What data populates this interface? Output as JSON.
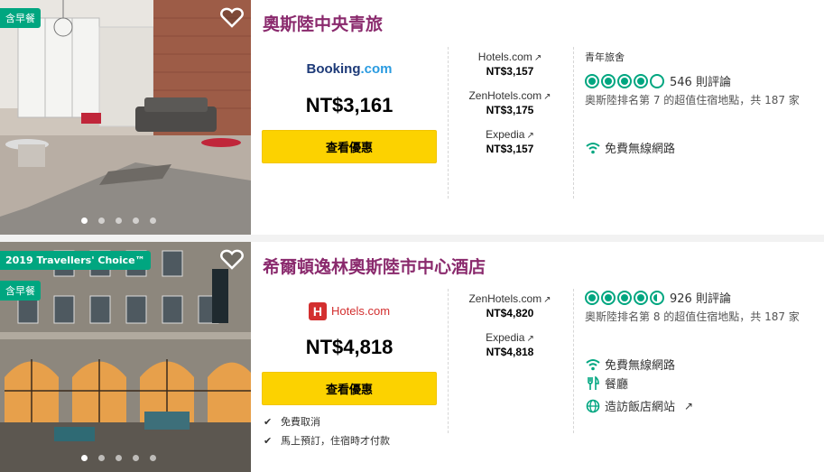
{
  "colors": {
    "brand": "#8a2a6d",
    "badge": "#00a680",
    "button": "#fcd200",
    "rating": "#00a680"
  },
  "hotels": [
    {
      "badge_breakfast": "含早餐",
      "title": "奧斯陸中央青旅",
      "provider": "Booking.com",
      "provider_part1": "Booking",
      "provider_part2": ".com",
      "price": "NT$3,161",
      "button": "查看優惠",
      "offers": [
        {
          "name": "Hotels.com",
          "price": "NT$3,157"
        },
        {
          "name": "ZenHotels.com",
          "price": "NT$3,175"
        },
        {
          "name": "Expedia",
          "price": "NT$3,157"
        }
      ],
      "category": "青年旅舍",
      "rating": 4,
      "reviews": "546 則評論",
      "rank": "奧斯陸排名第 7 的超值住宿地點，共 187 家",
      "amenities": [
        {
          "icon": "wifi-icon",
          "label": "免費無線網路"
        }
      ]
    },
    {
      "badge_award": "2019 Travellers' Choice™",
      "badge_breakfast": "含早餐",
      "title": "希爾頓逸林奧斯陸市中心酒店",
      "provider": "Hotels.com",
      "price": "NT$4,818",
      "button": "查看優惠",
      "perks": [
        "免費取消",
        "馬上預訂，住宿時才付款"
      ],
      "offers": [
        {
          "name": "ZenHotels.com",
          "price": "NT$4,820"
        },
        {
          "name": "Expedia",
          "price": "NT$4,818"
        }
      ],
      "rating": 4.5,
      "reviews": "926 則評論",
      "rank": "奧斯陸排名第 8 的超值住宿地點，共 187 家",
      "amenities": [
        {
          "icon": "wifi-icon",
          "label": "免費無線網路"
        },
        {
          "icon": "restaurant-icon",
          "label": "餐廳"
        },
        {
          "icon": "globe-icon",
          "label": "造訪飯店網站"
        }
      ]
    }
  ]
}
